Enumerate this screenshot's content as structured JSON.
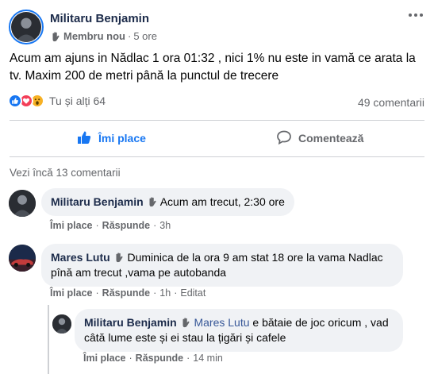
{
  "post": {
    "author": "Militaru Benjamin",
    "badge": "Membru nou",
    "separator": "·",
    "time": "5 ore",
    "text": "Acum am ajuns in Nădlac 1 ora 01:32 , nici 1% nu este in vamă ce arata la tv. Maxim 200 de metri până la punctul de trecere",
    "reactions_text": "Tu și alți 64",
    "comments_count": "49 comentarii",
    "like_label": "Îmi place",
    "comment_label": "Comentează",
    "see_more": "Vezi încă 13 comentarii"
  },
  "colors": {
    "accent": "#1877f2",
    "bubble": "#f0f2f5",
    "muted": "#65676b"
  },
  "comments": [
    {
      "author": "Militaru Benjamin",
      "text": "Acum am trecut, 2:30 ore",
      "like": "Îmi place",
      "reply": "Răspunde",
      "time": "3h"
    },
    {
      "author": "Mares Lutu",
      "text": "Duminica de la ora 9 am stat 18 ore la vama Nadlac pînă am trecut ,vama pe autobanda",
      "like": "Îmi place",
      "reply": "Răspunde",
      "time": "1h",
      "edited": "Editat"
    },
    {
      "author": "Militaru Benjamin",
      "mention": "Mares Lutu",
      "text": " e bătaie de joc oricum , vad câtă lume este și ei stau la țigări și cafele",
      "like": "Îmi place",
      "reply": "Răspunde",
      "time": "14 min"
    }
  ],
  "dot": "·"
}
